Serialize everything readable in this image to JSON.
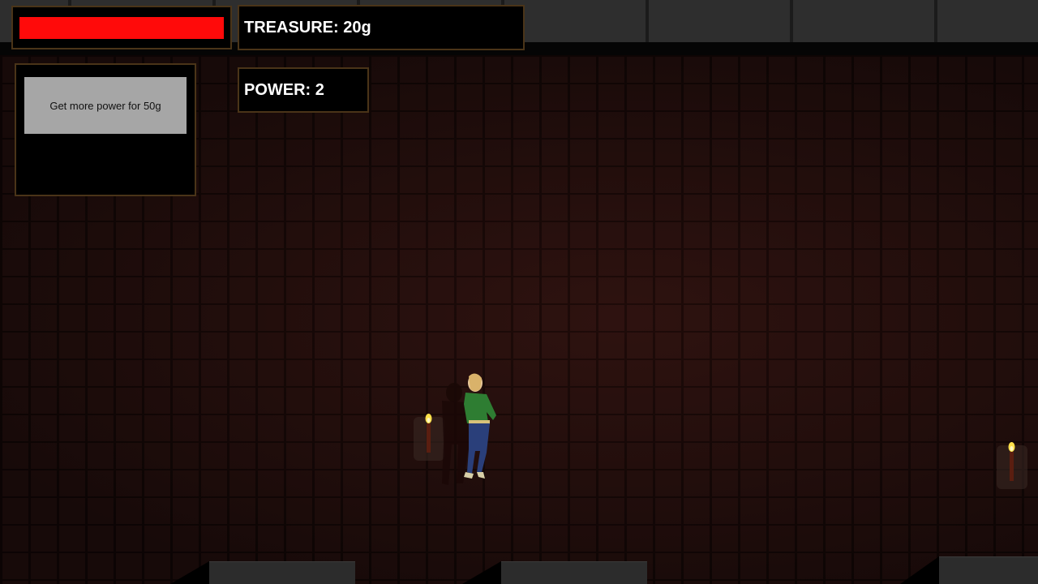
{
  "hud": {
    "health": {
      "fraction": 1.0,
      "color": "#ff0a0a"
    },
    "treasure": {
      "text": "TREASURE: 20g"
    },
    "power": {
      "text": "POWER: 2"
    },
    "shop": {
      "button_label": "Get more power for 50g"
    }
  },
  "scene": {
    "torches": [
      {
        "icon": "torch-icon"
      },
      {
        "icon": "torch-icon"
      }
    ],
    "player": {
      "icon": "player-character",
      "colors": {
        "shirt": "#2e7d32",
        "pants": "#2a3f7a",
        "hair": "#d9b26a"
      }
    },
    "colors": {
      "brick": "#2a1210",
      "mortar": "#150807",
      "ceiling": "#2e2e2e",
      "hud_border": "#4a3418"
    }
  }
}
